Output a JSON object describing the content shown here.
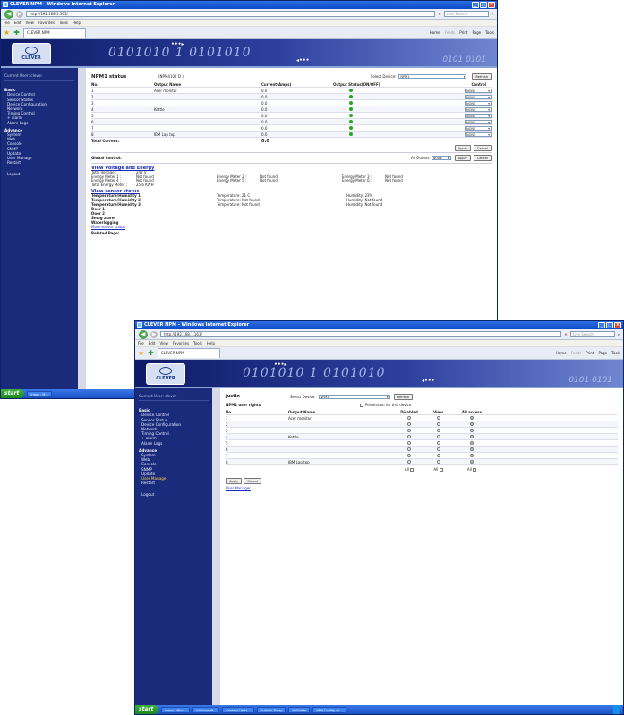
{
  "window1": {
    "title": "CLEVER NPM - Windows Internet Explorer",
    "url": "http://192.168.1.163/",
    "search_placeholder": "Live Search",
    "menu": [
      "File",
      "Edit",
      "View",
      "Favorites",
      "Tools",
      "Help"
    ],
    "tab": "CLEVER NPM",
    "tools": [
      "Home",
      "Feeds",
      "Print",
      "Page",
      "Tools"
    ],
    "sidebar": {
      "current_user": "Current User: clever",
      "basic_title": "Basic",
      "basic_items": [
        "Device Control",
        "Sensor Status",
        "Device Configuration",
        "Network",
        "Timing Control",
        "+ alarm",
        "Alarm Logs"
      ],
      "advance_title": "Advance",
      "advance_items": [
        "System",
        "Web",
        "Console",
        "SNMP",
        "Update",
        "User Manage",
        "Restart"
      ],
      "logout": "Logout"
    },
    "status": {
      "title": "NPM1 status",
      "device_id": "(NPM4102 D )",
      "select_device_label": "Select Device:",
      "select_device_value": "NPM1",
      "refresh": "Refresh",
      "headers": [
        "No.",
        "Output Name",
        "Current(Amps)",
        "Output Status(ON/OFF)",
        "Control"
      ],
      "rows": [
        {
          "no": "1",
          "name": "Acer monitor",
          "current": "0.0",
          "control": "NONE"
        },
        {
          "no": "2",
          "name": "",
          "current": "0.0",
          "control": "NONE"
        },
        {
          "no": "3",
          "name": "",
          "current": "0.0",
          "control": "NONE"
        },
        {
          "no": "4",
          "name": "Kettle",
          "current": "0.0",
          "control": "NONE"
        },
        {
          "no": "5",
          "name": "",
          "current": "0.0",
          "control": "NONE"
        },
        {
          "no": "6",
          "name": "",
          "current": "0.0",
          "control": "NONE"
        },
        {
          "no": "7",
          "name": "",
          "current": "0.0",
          "control": "NONE"
        },
        {
          "no": "8",
          "name": "IBM Lap top",
          "current": "0.0",
          "control": "NONE"
        }
      ],
      "total_current_label": "Total Current:",
      "total_current_value": "0.0",
      "apply": "Apply",
      "cancel": "Cancel",
      "global_control_label": "Global Control:",
      "all_outlets_label": "All Outlets",
      "all_outlets_value": "NONE"
    },
    "voltage": {
      "link": "View Voltage and Energy",
      "total_voltage_label": "Total Voltage :",
      "total_voltage_value": "242 V",
      "em1_label": "Energy Meter 1 :",
      "em1_value": "Not found",
      "em2_label": "Energy Meter 2 :",
      "em2_value": "Not found",
      "em3_label": "Energy Meter 3 :",
      "em3_value": "Not found",
      "em4_label": "Energy Meter 4 :",
      "em4_value": "Not found",
      "em5_label": "Energy Meter 5 :",
      "em5_value": "Not found",
      "em6_label": "Energy Meter 6 :",
      "em6_value": "Not found",
      "total_energy_label": "Total Energy Meter :",
      "total_energy_value": "25.6 KWH"
    },
    "sensor": {
      "link": "View sensor status",
      "rows": [
        {
          "label": "Temperature/Humidity 1",
          "temp": "Temperature: 21 C",
          "hum": "Humidity: 23%"
        },
        {
          "label": "Temperature/Humidity 2",
          "temp": "Temperature: Not found",
          "hum": "Humidity: Not found"
        },
        {
          "label": "Temperature/Humidity 3",
          "temp": "Temperature: Not found",
          "hum": "Humidity: Not found"
        }
      ],
      "door1": "Door 1",
      "door2": "Door 2",
      "smog": "Smog alarm",
      "water": "Waterlogging",
      "more_link": "More sensor status",
      "related": "Related Page:"
    },
    "taskbar": {
      "start": "start",
      "item": "Inbox - M..."
    }
  },
  "window2": {
    "title": "CLEVER NPM - Windows Internet Explorer",
    "url": "http://192.168.1.163/",
    "search_placeholder": "Live Search",
    "menu": [
      "File",
      "Edit",
      "View",
      "Favorites",
      "Tools",
      "Help"
    ],
    "tab": "CLEVER NPM",
    "tools": [
      "Home",
      "Feeds",
      "Print",
      "Page",
      "Tools"
    ],
    "sidebar": {
      "current_user": "Current User: clever",
      "basic_title": "Basic",
      "basic_items": [
        "Device Control",
        "Sensor Status",
        "Device Configuration",
        "Network",
        "Timing Control",
        "+ alarm",
        "Alarm Logs"
      ],
      "advance_title": "Advance",
      "advance_items": [
        "System",
        "Web",
        "Console",
        "SNMP",
        "Update",
        "User Manage",
        "Restart"
      ],
      "logout": "Logout"
    },
    "rights": {
      "user": "justin",
      "select_device_label": "Select Device:",
      "select_device_value": "NPM1",
      "refresh": "Refresh",
      "title": "NPM1 user rights",
      "permission_label": "Permission for this device",
      "headers": [
        "No.",
        "Output Name",
        "Disabled",
        "View",
        "All access"
      ],
      "rows": [
        {
          "no": "1",
          "name": "Acer monitor"
        },
        {
          "no": "2",
          "name": ""
        },
        {
          "no": "3",
          "name": ""
        },
        {
          "no": "4",
          "name": "Kettle"
        },
        {
          "no": "5",
          "name": ""
        },
        {
          "no": "6",
          "name": ""
        },
        {
          "no": "7",
          "name": ""
        },
        {
          "no": "8",
          "name": "IBM Lap top"
        }
      ],
      "all_label": "All",
      "apply": "Apply",
      "cancel": "Cancel",
      "user_manager_link": "User Manager"
    },
    "taskbar": {
      "start": "start",
      "items": [
        "Inbox - Micr...",
        "4 Microsoft...",
        "Contact Upda...",
        "Outlook Today",
        "WiGoInfo",
        "NPM Configura..."
      ]
    }
  }
}
